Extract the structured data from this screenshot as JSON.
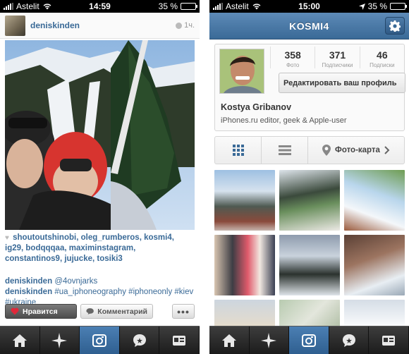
{
  "left": {
    "status": {
      "carrier": "Astelit",
      "time": "14:59",
      "battery": "35 %",
      "battery_level": 0.35
    },
    "post": {
      "username": "deniskinden",
      "time": "1ч.",
      "likes": [
        "shoutoutshinobi",
        "oleg_rumberos",
        "kosmi4",
        "ig29",
        "bodqqqaa",
        "maximinstagram",
        "constantinos9",
        "jujucke",
        "tosiki3"
      ],
      "caption_user": "deniskinden",
      "caption_mention": "@4ovnjarks",
      "caption_user2": "deniskinden",
      "caption_tags": "#ua_iphoneography #iphoneonly #kiev #ukraine",
      "like_label": "Нравится",
      "comment_label": "Комментарий",
      "more_label": "•••"
    }
  },
  "right": {
    "status": {
      "carrier": "Astelit",
      "time": "15:00",
      "battery": "35 %",
      "battery_level": 0.35
    },
    "nav_title": "KOSMI4",
    "profile": {
      "posts_count": "358",
      "posts_label": "Фото",
      "followers_count": "371",
      "followers_label": "Подписчики",
      "following_count": "46",
      "following_label": "Подписки",
      "edit_label": "Редактировать ваш профиль",
      "name": "Kostya Gribanov",
      "bio": "iPhones.ru editor, geek & Apple-user"
    },
    "photo_map_label": "Фото-карта"
  },
  "tabbar": [
    "home-icon",
    "explore-icon",
    "camera-icon",
    "news-icon",
    "profile-icon"
  ],
  "colors": {
    "accent": "#3a6a97",
    "nav_top": "#5d8ab7",
    "nav_bottom": "#3a6a97",
    "like_heart": "#e0283a"
  }
}
